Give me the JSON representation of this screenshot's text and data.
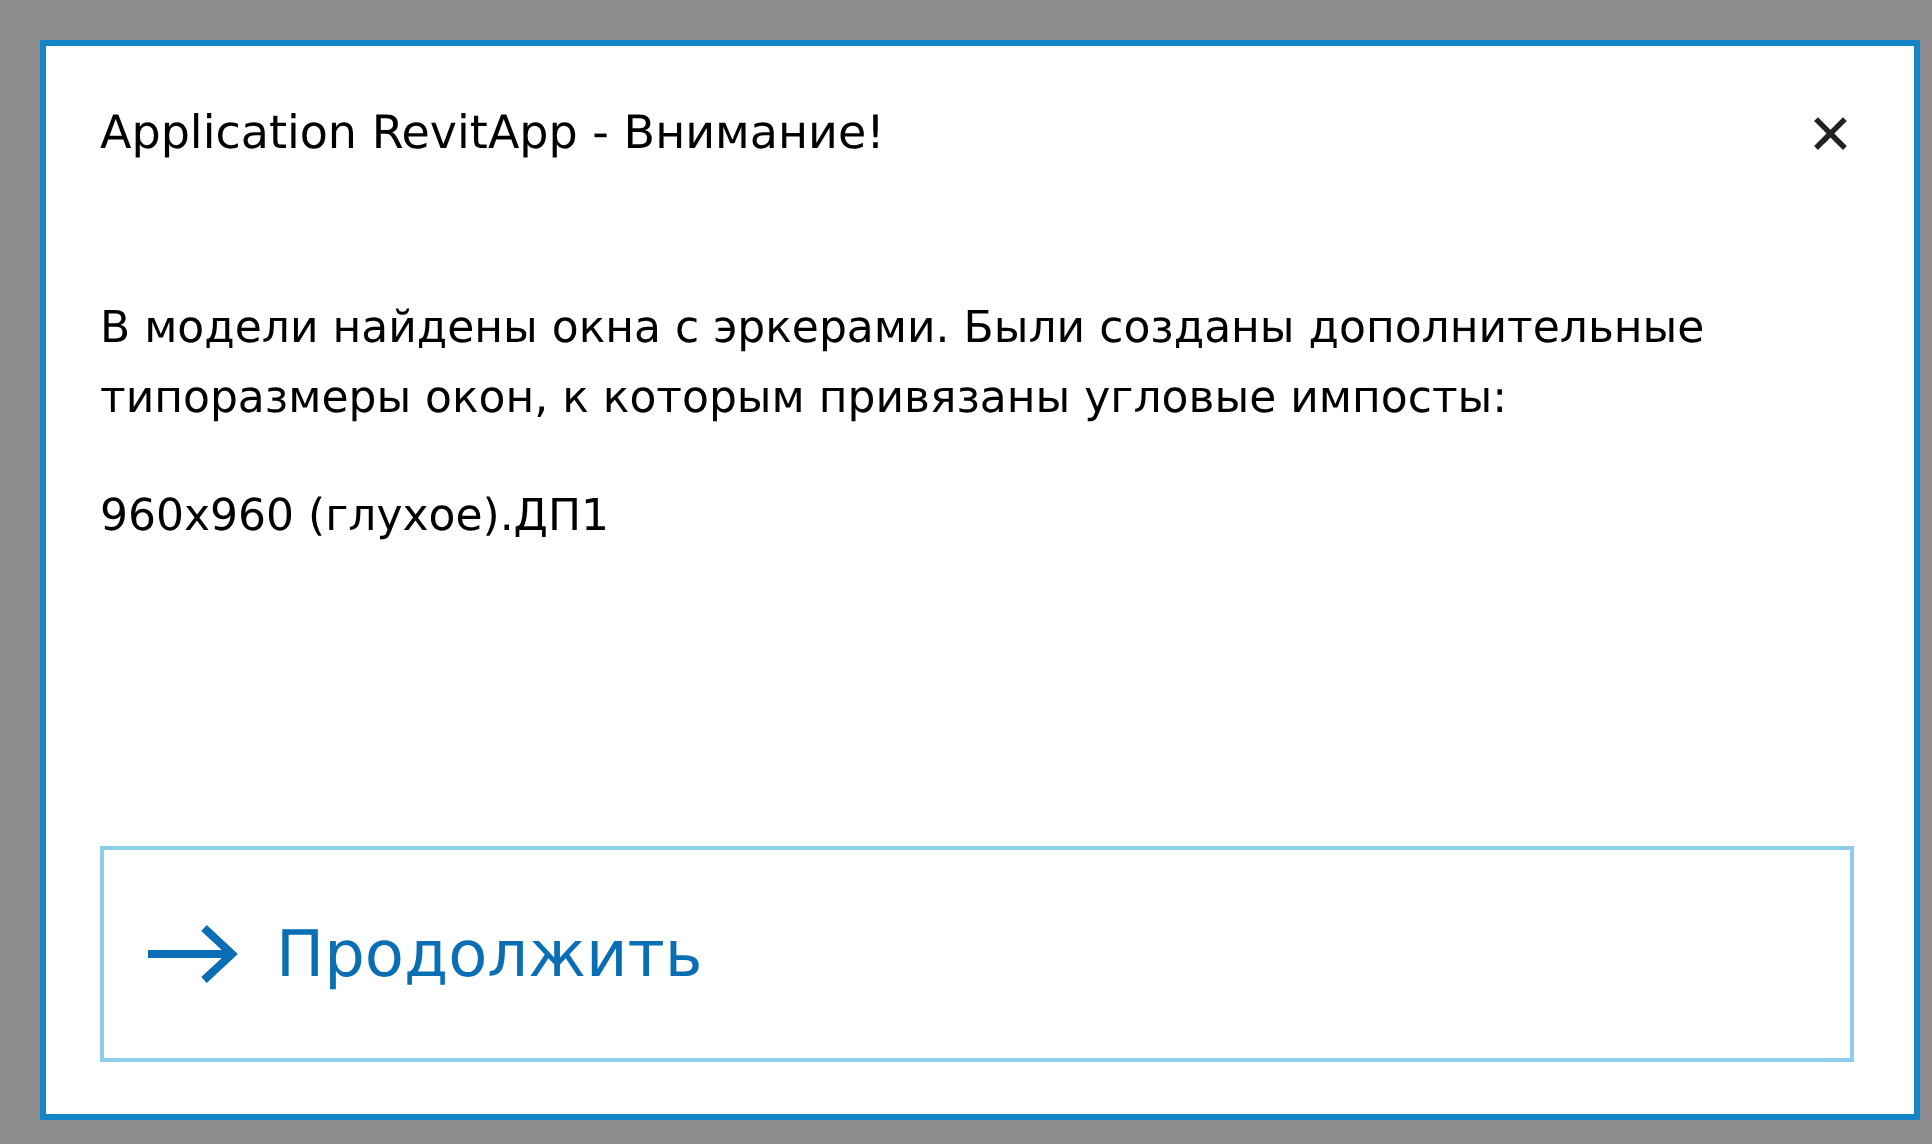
{
  "window": {
    "title": "Application RevitApp - Внимание!",
    "close": "✕"
  },
  "message": [
    "В модели найдены окна с эркерами. Были созданы дополнительные типоразмеры окон, к которым привязаны угловые импосты:",
    "960x960 (глухое).ДП1"
  ],
  "button": {
    "label": "Продолжить"
  }
}
